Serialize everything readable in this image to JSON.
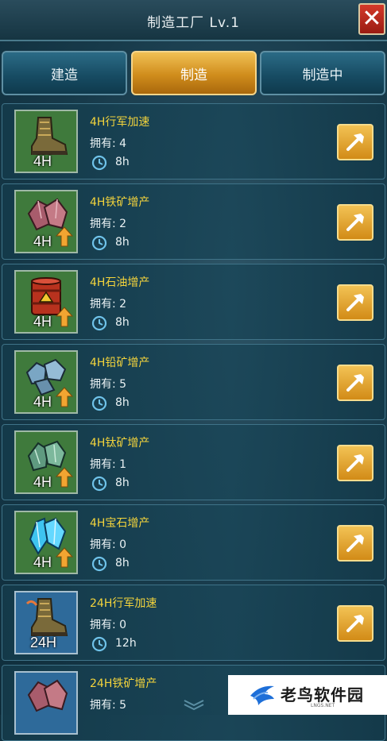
{
  "header": {
    "title": "制造工厂 Lv.1",
    "close_glyph": "✕"
  },
  "tabs": [
    {
      "label": "建造",
      "active": false
    },
    {
      "label": "制造",
      "active": true
    },
    {
      "label": "制造中",
      "active": false
    }
  ],
  "items": [
    {
      "name": "4H行军加速",
      "owned": "拥有: 4",
      "time": "8h",
      "duration": "4H",
      "icon": "boot-icon"
    },
    {
      "name": "4H铁矿增产",
      "owned": "拥有: 2",
      "time": "8h",
      "duration": "4H",
      "icon": "iron-ore-icon"
    },
    {
      "name": "4H石油增产",
      "owned": "拥有: 2",
      "time": "8h",
      "duration": "4H",
      "icon": "oil-barrel-icon"
    },
    {
      "name": "4H铅矿增产",
      "owned": "拥有: 5",
      "time": "8h",
      "duration": "4H",
      "icon": "lead-ore-icon"
    },
    {
      "name": "4H钛矿增产",
      "owned": "拥有: 1",
      "time": "8h",
      "duration": "4H",
      "icon": "titanium-ore-icon"
    },
    {
      "name": "4H宝石增产",
      "owned": "拥有: 0",
      "time": "8h",
      "duration": "4H",
      "icon": "gem-icon"
    },
    {
      "name": "24H行军加速",
      "owned": "拥有: 0",
      "time": "12h",
      "duration": "24H",
      "icon": "boot-icon"
    },
    {
      "name": "24H铁矿增产",
      "owned": "拥有: 5",
      "time": "",
      "duration": "",
      "icon": "iron-ore-icon"
    }
  ],
  "watermark": {
    "name": "老鸟软件园",
    "sub": "LNGS.NET"
  },
  "colors": {
    "accent_gold": "#f2d33c",
    "tab_active": "#d08d1c",
    "panel": "#163f52"
  }
}
